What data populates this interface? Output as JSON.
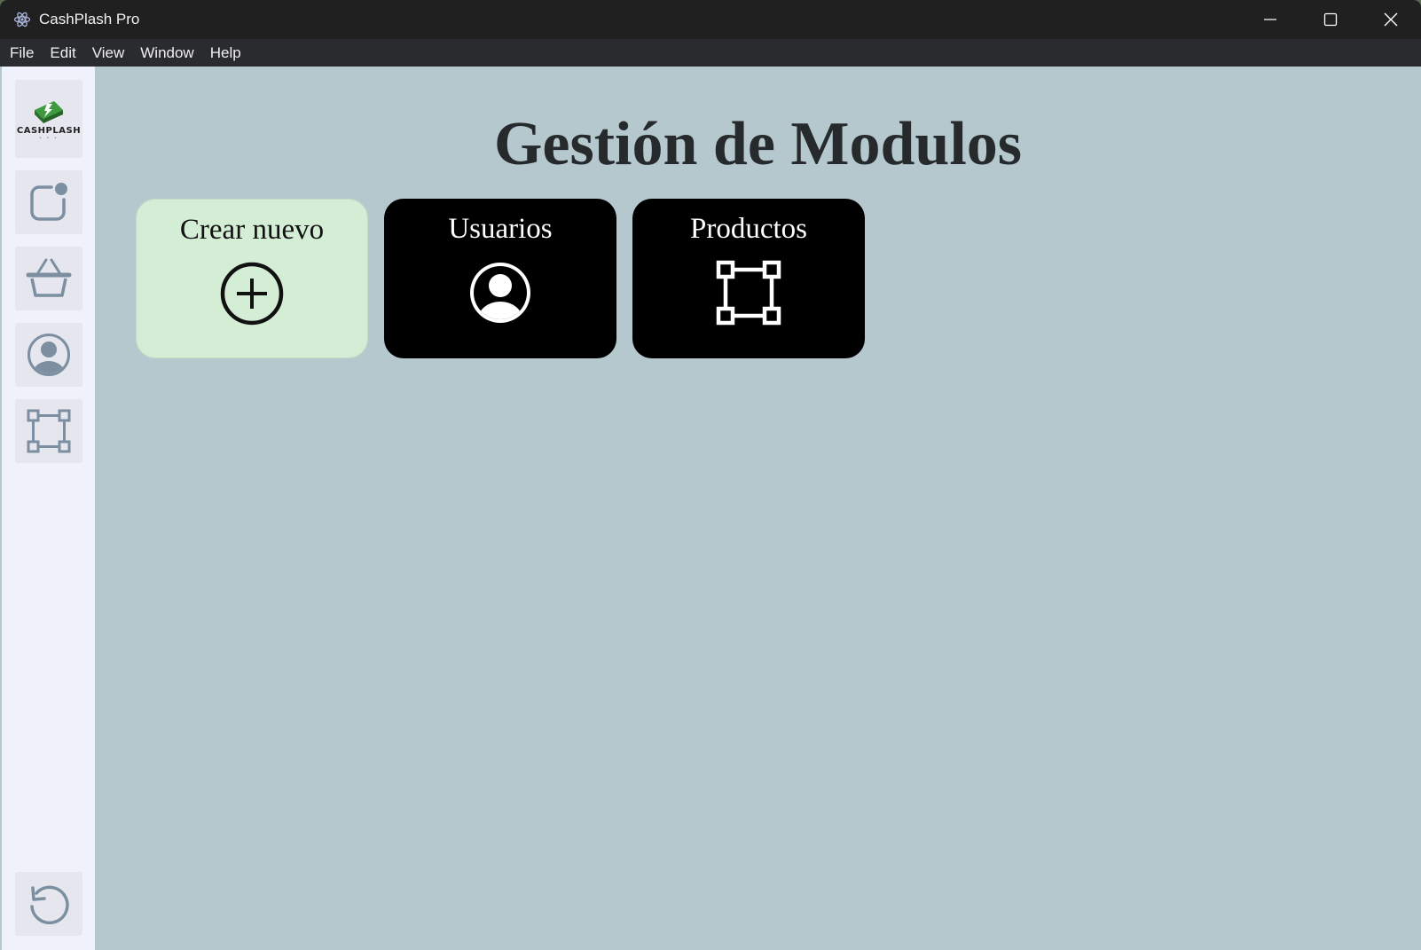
{
  "window": {
    "title": "CashPlash Pro",
    "icon": "electron-atom-icon"
  },
  "menu": {
    "items": [
      "File",
      "Edit",
      "View",
      "Window",
      "Help"
    ]
  },
  "sidebar": {
    "logo_text": "CASHPLASH",
    "items": [
      {
        "name": "notification-square-icon"
      },
      {
        "name": "basket-icon"
      },
      {
        "name": "user-circle-icon"
      },
      {
        "name": "modules-frame-icon"
      }
    ],
    "bottom_item": {
      "name": "history-rotate-icon"
    },
    "icon_color": "#7b8fa0"
  },
  "main": {
    "title": "Gestión de Modulos",
    "cards": [
      {
        "label": "Crear nuevo",
        "icon": "plus-circle-icon",
        "style": "light"
      },
      {
        "label": "Usuarios",
        "icon": "user-circle-icon",
        "style": "dark"
      },
      {
        "label": "Productos",
        "icon": "modules-frame-icon",
        "style": "dark"
      }
    ]
  },
  "colors": {
    "titlebar": "#202020",
    "menubar": "#2a2b2e",
    "sidebar": "#eff1fb",
    "main_bg": "#b4c8ce",
    "card_new": "#d3eed5",
    "card_dark": "#000000",
    "logo_green": "#4caf50"
  }
}
